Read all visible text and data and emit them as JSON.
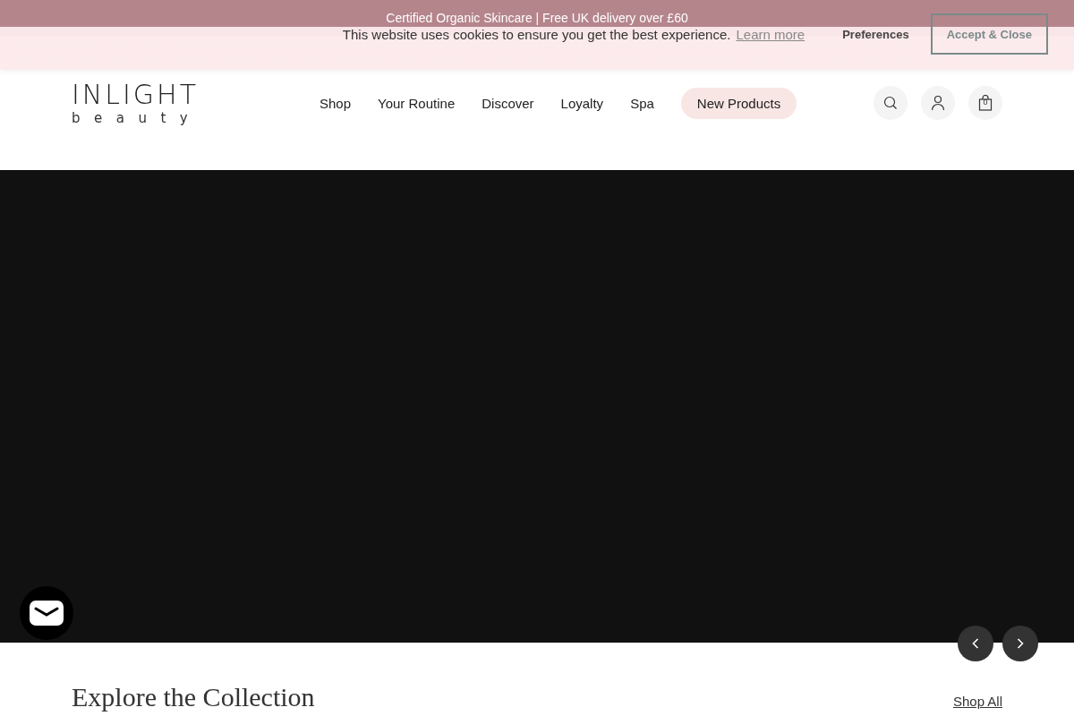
{
  "announcement": {
    "text": "Certified Organic Skincare | Free UK delivery over £60"
  },
  "cookie_banner": {
    "message": "This website uses cookies to ensure you get the best experience.",
    "link": "Learn more",
    "buttons": [
      {
        "label": "Preferences",
        "kind": "plain"
      },
      {
        "label": "Accept & Close",
        "kind": "outlined"
      }
    ]
  },
  "header": {
    "logo": {
      "wordmark": "INLIGHT",
      "tagline": "beauty"
    },
    "nav": [
      {
        "label": "Shop",
        "highlighted": false
      },
      {
        "label": "Your Routine",
        "highlighted": false
      },
      {
        "label": "Discover",
        "highlighted": false
      },
      {
        "label": "Loyalty",
        "highlighted": false
      },
      {
        "label": "Spa",
        "highlighted": false
      },
      {
        "label": "New Products",
        "highlighted": true
      }
    ],
    "cart_count": "0"
  },
  "section": {
    "title": "Explore the Collection",
    "link": "Shop All"
  }
}
